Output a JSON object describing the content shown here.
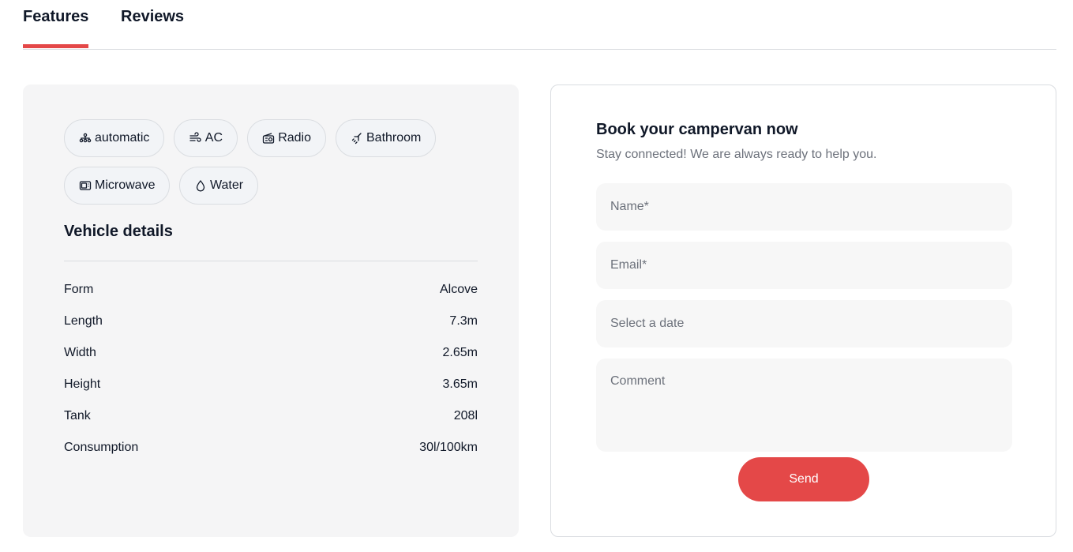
{
  "tabs": {
    "features": "Features",
    "reviews": "Reviews",
    "active": "Features",
    "accent_color": "#e44848"
  },
  "features": {
    "chips": [
      {
        "icon": "transmission-icon",
        "label": "automatic"
      },
      {
        "icon": "wind-icon",
        "label": "AC"
      },
      {
        "icon": "radio-icon",
        "label": "Radio"
      },
      {
        "icon": "shower-icon",
        "label": "Bathroom"
      },
      {
        "icon": "microwave-icon",
        "label": "Microwave"
      },
      {
        "icon": "water-drop-icon",
        "label": "Water"
      }
    ],
    "details_title": "Vehicle details",
    "details": [
      {
        "label": "Form",
        "value": "Alcove"
      },
      {
        "label": "Length",
        "value": "7.3m"
      },
      {
        "label": "Width",
        "value": "2.65m"
      },
      {
        "label": "Height",
        "value": "3.65m"
      },
      {
        "label": "Tank",
        "value": "208l"
      },
      {
        "label": "Consumption",
        "value": "30l/100km"
      }
    ]
  },
  "booking": {
    "title": "Book your campervan now",
    "subtitle": "Stay connected! We are always ready to help you.",
    "name_placeholder": "Name*",
    "email_placeholder": "Email*",
    "date_placeholder": "Select a date",
    "comment_placeholder": "Comment",
    "send_label": "Send"
  }
}
